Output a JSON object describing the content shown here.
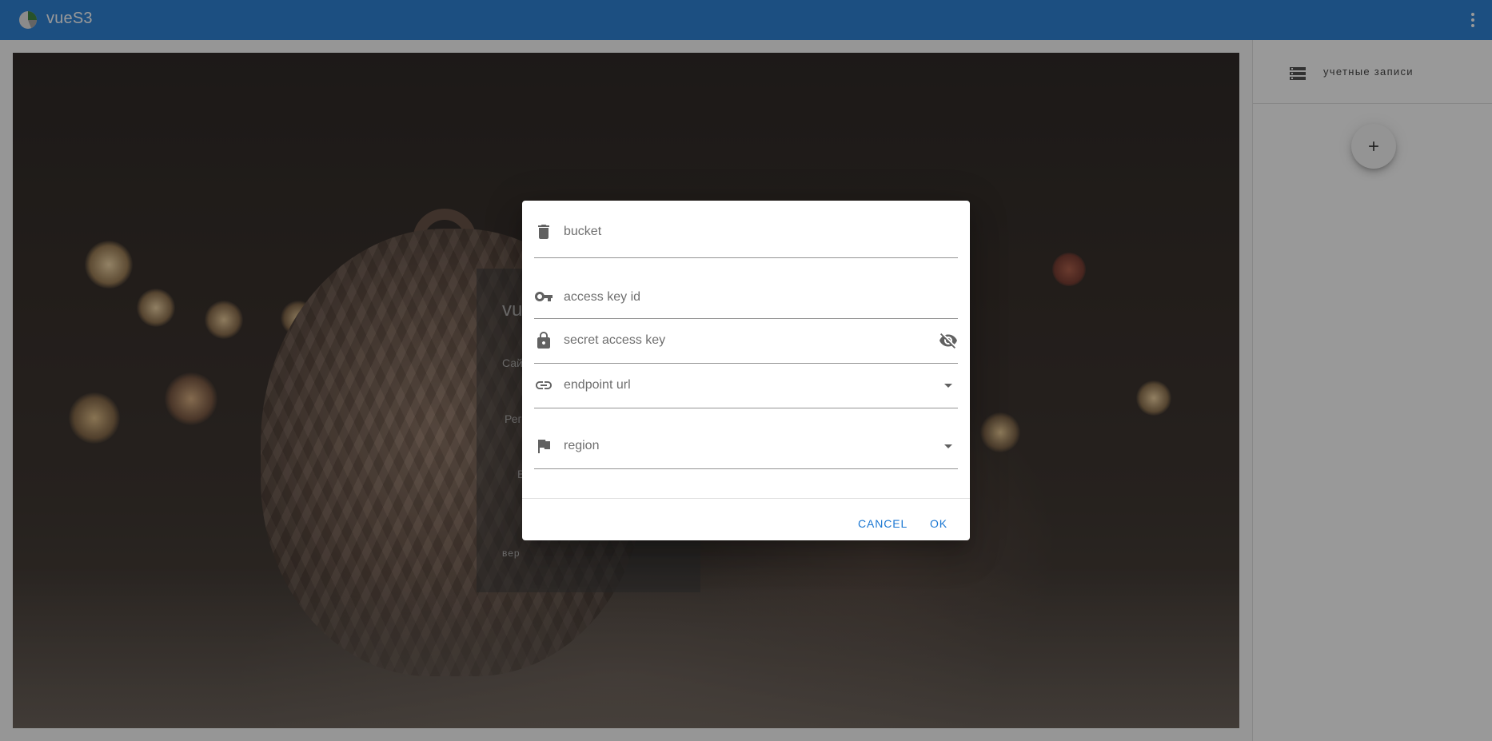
{
  "appbar": {
    "title": "vueS3",
    "logo_icon": "pie-chart-logo",
    "menu_icon": "dots-vertical-icon",
    "color": "#1976d2"
  },
  "login_card": {
    "title": "vu",
    "site_label": "Сай",
    "region_label": "Рег",
    "login_label": "В",
    "version_label": "вер"
  },
  "drawer": {
    "title": "учетные записи",
    "header_icon": "storage-list-icon",
    "add_button_icon": "plus-icon"
  },
  "dialog": {
    "fields": {
      "bucket": {
        "placeholder": "bucket",
        "value": "",
        "icon": "trash-can-icon"
      },
      "access_key_id": {
        "placeholder": "access key id",
        "value": "",
        "icon": "key-icon"
      },
      "secret_access_key": {
        "placeholder": "secret access key",
        "value": "",
        "icon": "lock-icon",
        "append_icon": "eye-off-icon"
      },
      "endpoint_url": {
        "placeholder": "endpoint url",
        "value": "",
        "icon": "link-icon",
        "append_icon": "menu-down-icon"
      },
      "region": {
        "placeholder": "region",
        "value": "",
        "icon": "flag-icon",
        "append_icon": "menu-down-icon"
      }
    },
    "actions": {
      "cancel_label": "CANCEL",
      "ok_label": "OK"
    },
    "accent_color": "#1976d2"
  }
}
